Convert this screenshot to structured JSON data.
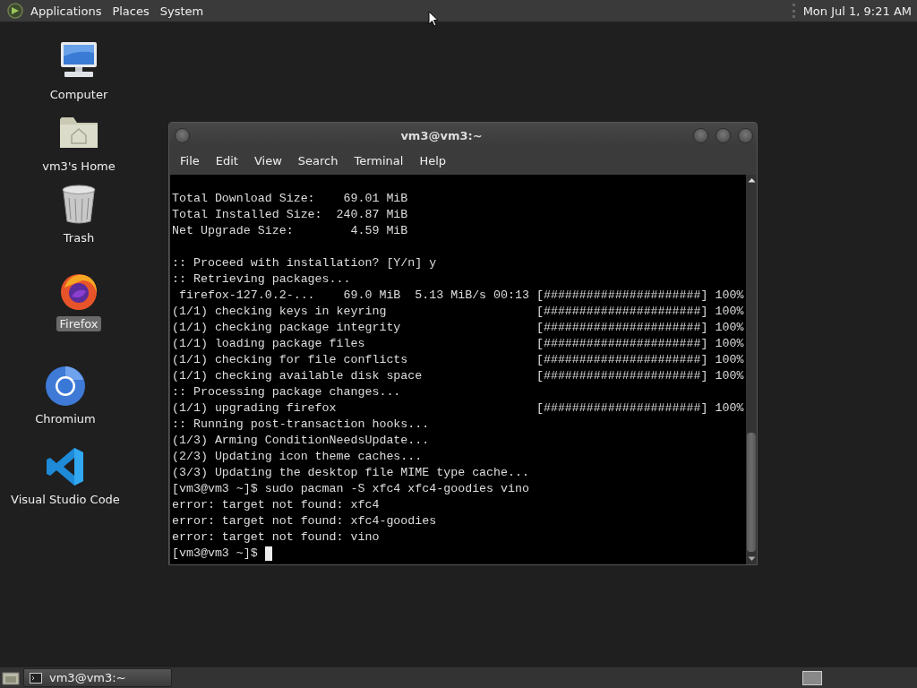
{
  "top_panel": {
    "menus": [
      "Applications",
      "Places",
      "System"
    ],
    "clock": "Mon Jul  1,  9:21 AM"
  },
  "desktop_icons": [
    {
      "kind": "computer",
      "label": "Computer",
      "selected": false
    },
    {
      "kind": "home",
      "label": "vm3's Home",
      "selected": false
    },
    {
      "kind": "trash",
      "label": "Trash",
      "selected": false
    },
    {
      "kind": "firefox",
      "label": "Firefox",
      "selected": true
    },
    {
      "kind": "chromium",
      "label": "Chromium",
      "selected": false
    },
    {
      "kind": "vscode",
      "label": "Visual Studio Code",
      "selected": false
    }
  ],
  "terminal": {
    "title": "vm3@vm3:~",
    "menus": [
      "File",
      "Edit",
      "View",
      "Search",
      "Terminal",
      "Help"
    ],
    "lines": [
      {
        "kind": "text",
        "text": "Total Download Size:    69.01 MiB"
      },
      {
        "kind": "text",
        "text": "Total Installed Size:  240.87 MiB"
      },
      {
        "kind": "text",
        "text": "Net Upgrade Size:        4.59 MiB"
      },
      {
        "kind": "blank"
      },
      {
        "kind": "text",
        "text": ":: Proceed with installation? [Y/n] y"
      },
      {
        "kind": "text",
        "text": ":: Retrieving packages..."
      },
      {
        "kind": "text",
        "text": " firefox-127.0.2-...    69.0 MiB  5.13 MiB/s 00:13 [######################] 100%"
      },
      {
        "kind": "text",
        "text": "(1/1) checking keys in keyring                     [######################] 100%"
      },
      {
        "kind": "text",
        "text": "(1/1) checking package integrity                   [######################] 100%"
      },
      {
        "kind": "text",
        "text": "(1/1) loading package files                        [######################] 100%"
      },
      {
        "kind": "text",
        "text": "(1/1) checking for file conflicts                  [######################] 100%"
      },
      {
        "kind": "text",
        "text": "(1/1) checking available disk space                [######################] 100%"
      },
      {
        "kind": "text",
        "text": ":: Processing package changes..."
      },
      {
        "kind": "text",
        "text": "(1/1) upgrading firefox                            [######################] 100%"
      },
      {
        "kind": "text",
        "text": ":: Running post-transaction hooks..."
      },
      {
        "kind": "text",
        "text": "(1/3) Arming ConditionNeedsUpdate..."
      },
      {
        "kind": "text",
        "text": "(2/3) Updating icon theme caches..."
      },
      {
        "kind": "text",
        "text": "(3/3) Updating the desktop file MIME type cache..."
      },
      {
        "kind": "text",
        "text": "[vm3@vm3 ~]$ sudo pacman -S xfc4 xfc4-goodies vino"
      },
      {
        "kind": "text",
        "text": "error: target not found: xfc4"
      },
      {
        "kind": "text",
        "text": "error: target not found: xfc4-goodies"
      },
      {
        "kind": "text",
        "text": "error: target not found: vino"
      },
      {
        "kind": "text",
        "text": "[vm3@vm3 ~]$ "
      }
    ],
    "cursor": true
  },
  "taskbar": {
    "tasks": [
      {
        "label": "vm3@vm3:~",
        "selected": false
      }
    ]
  }
}
